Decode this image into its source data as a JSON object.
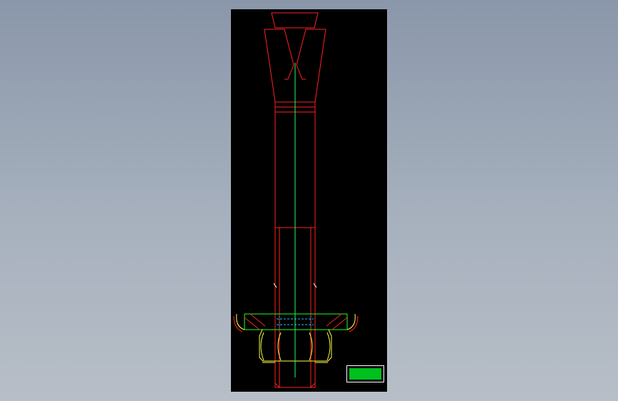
{
  "colors": {
    "background_gradient_top": "#8a97aa",
    "background_gradient_bottom": "#b7bec7",
    "drawing_area": "#000000",
    "bolt_outline": "#ff2020",
    "centerline": "#20ff60",
    "washer": "#20ff20",
    "nut": "#ffff40",
    "thread_detail": "#20c0ff",
    "stamp_fill": "#00c020"
  },
  "stamp": {
    "logo_text": "",
    "icon": "company-logo-stamp"
  }
}
